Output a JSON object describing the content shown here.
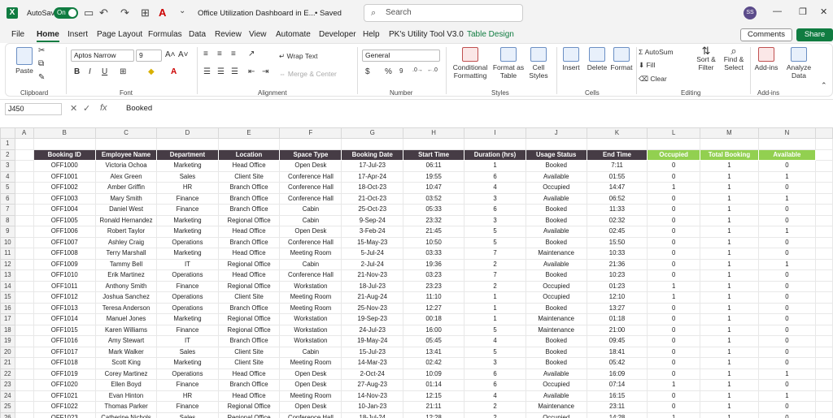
{
  "app": {
    "autosave_label": "AutoSave",
    "autosave_state": "On",
    "doc_title": "Office Utilization Dashboard in E...",
    "saved_status": "• Saved",
    "search_placeholder": "Search",
    "user_initials": "SS"
  },
  "menu_tabs": [
    "File",
    "Home",
    "Insert",
    "Page Layout",
    "Formulas",
    "Data",
    "Review",
    "View",
    "Automate",
    "Developer",
    "Help",
    "PK's Utility Tool V3.0",
    "Table Design"
  ],
  "actions": {
    "comments": "Comments",
    "share": "Share"
  },
  "ribbon": {
    "clipboard": {
      "label": "Clipboard",
      "paste": "Paste"
    },
    "font": {
      "label": "Font",
      "name": "Aptos Narrow",
      "size": "9"
    },
    "alignment": {
      "label": "Alignment",
      "wrap": "Wrap Text",
      "merge": "Merge & Center"
    },
    "number": {
      "label": "Number",
      "format": "General"
    },
    "styles": {
      "label": "Styles",
      "conditional": "Conditional",
      "formatting": "Formatting",
      "format_as": "Format as",
      "table": "Table",
      "cell": "Cell",
      "cell_styles": "Styles"
    },
    "cells": {
      "label": "Cells",
      "insert": "Insert",
      "delete": "Delete",
      "format": "Format"
    },
    "editing": {
      "label": "Editing",
      "autosum": "AutoSum",
      "fill": "Fill",
      "clear": "Clear",
      "sort": "Sort &",
      "filter": "Filter",
      "find": "Find &",
      "select": "Select"
    },
    "addins": {
      "label": "Add-ins",
      "addins": "Add-ins",
      "analyze": "Analyze",
      "data": "Data"
    }
  },
  "formula_bar": {
    "cell_ref": "J450",
    "value": "Booked"
  },
  "sheet": {
    "columns": [
      "A",
      "B",
      "C",
      "D",
      "E",
      "F",
      "G",
      "H",
      "I",
      "J",
      "K",
      "L",
      "M",
      "N"
    ],
    "headers": [
      "Booking ID",
      "Employee Name",
      "Department",
      "Location",
      "Space Type",
      "Booking Date",
      "Start Time",
      "Duration (hrs)",
      "Usage Status",
      "End Time"
    ],
    "summary_headers": [
      "Occupied",
      "Total Booking",
      "Available"
    ],
    "rows": [
      [
        "OFF1000",
        "Victoria Ochoa",
        "Marketing",
        "Head Office",
        "Open Desk",
        "17-Jul-23",
        "06:11",
        "1",
        "Booked",
        "7:11",
        "0",
        "1",
        "0"
      ],
      [
        "OFF1001",
        "Alex Green",
        "Sales",
        "Client Site",
        "Conference Hall",
        "17-Apr-24",
        "19:55",
        "6",
        "Available",
        "01:55",
        "0",
        "1",
        "1"
      ],
      [
        "OFF1002",
        "Amber Griffin",
        "HR",
        "Branch Office",
        "Conference Hall",
        "18-Oct-23",
        "10:47",
        "4",
        "Occupied",
        "14:47",
        "1",
        "1",
        "0"
      ],
      [
        "OFF1003",
        "Mary Smith",
        "Finance",
        "Branch Office",
        "Conference Hall",
        "21-Oct-23",
        "03:52",
        "3",
        "Available",
        "06:52",
        "0",
        "1",
        "1"
      ],
      [
        "OFF1004",
        "Daniel West",
        "Finance",
        "Branch Office",
        "Cabin",
        "25-Oct-23",
        "05:33",
        "6",
        "Booked",
        "11:33",
        "0",
        "1",
        "0"
      ],
      [
        "OFF1005",
        "Ronald Hernandez",
        "Marketing",
        "Regional Office",
        "Cabin",
        "9-Sep-24",
        "23:32",
        "3",
        "Booked",
        "02:32",
        "0",
        "1",
        "0"
      ],
      [
        "OFF1006",
        "Robert Taylor",
        "Marketing",
        "Head Office",
        "Open Desk",
        "3-Feb-24",
        "21:45",
        "5",
        "Available",
        "02:45",
        "0",
        "1",
        "1"
      ],
      [
        "OFF1007",
        "Ashley Craig",
        "Operations",
        "Branch Office",
        "Conference Hall",
        "15-May-23",
        "10:50",
        "5",
        "Booked",
        "15:50",
        "0",
        "1",
        "0"
      ],
      [
        "OFF1008",
        "Terry Marshall",
        "Marketing",
        "Head Office",
        "Meeting Room",
        "5-Jul-24",
        "03:33",
        "7",
        "Maintenance",
        "10:33",
        "0",
        "1",
        "0"
      ],
      [
        "OFF1009",
        "Tammy Bell",
        "IT",
        "Regional Office",
        "Cabin",
        "2-Jul-24",
        "19:36",
        "2",
        "Available",
        "21:36",
        "0",
        "1",
        "1"
      ],
      [
        "OFF1010",
        "Erik Martinez",
        "Operations",
        "Head Office",
        "Conference Hall",
        "21-Nov-23",
        "03:23",
        "7",
        "Booked",
        "10:23",
        "0",
        "1",
        "0"
      ],
      [
        "OFF1011",
        "Anthony Smith",
        "Finance",
        "Regional Office",
        "Workstation",
        "18-Jul-23",
        "23:23",
        "2",
        "Occupied",
        "01:23",
        "1",
        "1",
        "0"
      ],
      [
        "OFF1012",
        "Joshua Sanchez",
        "Operations",
        "Client Site",
        "Meeting Room",
        "21-Aug-24",
        "11:10",
        "1",
        "Occupied",
        "12:10",
        "1",
        "1",
        "0"
      ],
      [
        "OFF1013",
        "Teresa Anderson",
        "Operations",
        "Branch Office",
        "Meeting Room",
        "25-Nov-23",
        "12:27",
        "1",
        "Booked",
        "13:27",
        "0",
        "1",
        "0"
      ],
      [
        "OFF1014",
        "Manuel Jones",
        "Marketing",
        "Regional Office",
        "Workstation",
        "19-Sep-23",
        "00:18",
        "1",
        "Maintenance",
        "01:18",
        "0",
        "1",
        "0"
      ],
      [
        "OFF1015",
        "Karen Williams",
        "Finance",
        "Regional Office",
        "Workstation",
        "24-Jul-23",
        "16:00",
        "5",
        "Maintenance",
        "21:00",
        "0",
        "1",
        "0"
      ],
      [
        "OFF1016",
        "Amy Stewart",
        "IT",
        "Branch Office",
        "Workstation",
        "19-May-24",
        "05:45",
        "4",
        "Booked",
        "09:45",
        "0",
        "1",
        "0"
      ],
      [
        "OFF1017",
        "Mark Walker",
        "Sales",
        "Client Site",
        "Cabin",
        "15-Jul-23",
        "13:41",
        "5",
        "Booked",
        "18:41",
        "0",
        "1",
        "0"
      ],
      [
        "OFF1018",
        "Scott King",
        "Marketing",
        "Client Site",
        "Meeting Room",
        "14-Mar-23",
        "02:42",
        "3",
        "Booked",
        "05:42",
        "0",
        "1",
        "0"
      ],
      [
        "OFF1019",
        "Corey Martinez",
        "Operations",
        "Head Office",
        "Open Desk",
        "2-Oct-24",
        "10:09",
        "6",
        "Available",
        "16:09",
        "0",
        "1",
        "1"
      ],
      [
        "OFF1020",
        "Ellen Boyd",
        "Finance",
        "Branch Office",
        "Open Desk",
        "27-Aug-23",
        "01:14",
        "6",
        "Occupied",
        "07:14",
        "1",
        "1",
        "0"
      ],
      [
        "OFF1021",
        "Evan Hinton",
        "HR",
        "Head Office",
        "Meeting Room",
        "14-Nov-23",
        "12:15",
        "4",
        "Available",
        "16:15",
        "0",
        "1",
        "1"
      ],
      [
        "OFF1022",
        "Thomas Parker",
        "Finance",
        "Regional Office",
        "Open Desk",
        "10-Jan-23",
        "21:11",
        "2",
        "Maintenance",
        "23:11",
        "0",
        "1",
        "0"
      ],
      [
        "OFF1023",
        "Catherine Nichols",
        "Sales",
        "Regional Office",
        "Conference Hall",
        "18-Jul-24",
        "12:28",
        "2",
        "Occupied",
        "14:28",
        "1",
        "1",
        "0"
      ]
    ]
  }
}
